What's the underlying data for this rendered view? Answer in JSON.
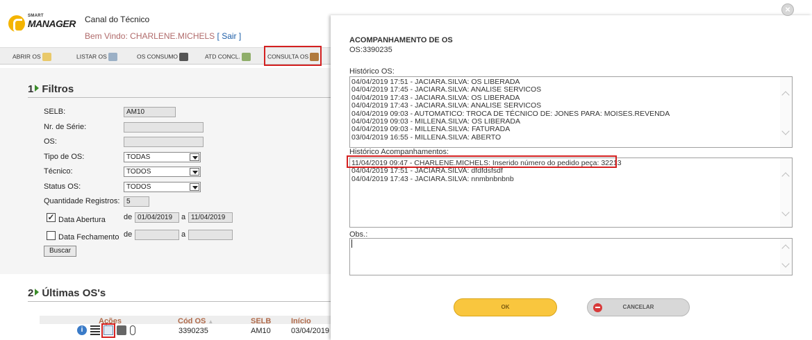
{
  "header": {
    "logo_small": "SMART",
    "logo_big": "MANAGER",
    "title": "Canal do Técnico",
    "welcome_text": "Bem Vindo: CHARLENE.MICHELS",
    "logout": "[ Sair ]"
  },
  "nav": {
    "items": [
      "ABRIR OS",
      "LISTAR OS",
      "OS CONSUMO",
      "ATD CONCL.",
      "CONSULTA OS"
    ],
    "active": "CONSULTA OS"
  },
  "filters": {
    "section_num": "1",
    "section_title": "Filtros",
    "selb_label": "SELB:",
    "selb_value": "AM10",
    "serie_label": "Nr. de Série:",
    "os_label": "OS:",
    "tipo_label": "Tipo de OS:",
    "tipo_value": "TODAS",
    "tecnico_label": "Técnico:",
    "tecnico_value": "TODOS",
    "status_label": "Status OS:",
    "status_value": "TODOS",
    "qtd_label": "Quantidade Registros:",
    "qtd_value": "5",
    "abertura_label": "Data Abertura",
    "abertura_checked": true,
    "de_label": "de",
    "a_label": "a",
    "abertura_from": "01/04/2019",
    "abertura_to": "11/04/2019",
    "fechamento_label": "Data Fechamento",
    "fechamento_checked": false,
    "search_button": "Buscar"
  },
  "latest": {
    "section_num": "2",
    "section_title": "Últimas OS's",
    "columns": [
      "Ações",
      "Cód OS",
      "SELB",
      "Início"
    ],
    "rows": [
      {
        "cod_os": "3390235",
        "selb": "AM10",
        "inicio": "03/04/2019"
      }
    ]
  },
  "modal": {
    "title": "ACOMPANHAMENTO DE OS",
    "os_label": "OS:3390235",
    "historico_label": "Histórico OS:",
    "historico": [
      "04/04/2019 17:51 - JACIARA.SILVA: OS LIBERADA",
      "04/04/2019 17:45 - JACIARA.SILVA: ANALISE SERVICOS",
      "04/04/2019 17:43 - JACIARA.SILVA: OS LIBERADA",
      "04/04/2019 17:43 - JACIARA.SILVA: ANALISE SERVICOS",
      "04/04/2019 09:03 - AUTOMATICO: TROCA DE TÉCNICO    DE: JONES  PARA: MOISES.REVENDA",
      "04/04/2019 09:03 - MILLENA.SILVA: OS LIBERADA",
      "04/04/2019 09:03 - MILLENA.SILVA: FATURADA",
      "03/04/2019 16:55 - MILLENA.SILVA: ABERTO"
    ],
    "acompanhamentos_label": "Histórico Acompanhamentos:",
    "acompanhamentos": [
      "11/04/2019 09:47 - CHARLENE.MICHELS: Inserido número do pedido peça: 32213",
      "04/04/2019 17:51 - JACIARA.SILVA: dfdfdsfsdf",
      "04/04/2019 17:43 - JACIARA.SILVA: nnmbnbnbnb"
    ],
    "obs_label": "Obs.:",
    "obs_value": "",
    "ok_button": "OK",
    "cancel_button": "CANCELAR"
  },
  "colors": {
    "highlight": "#d42020",
    "ok": "#f9c63e",
    "cancel": "#d8d8d8",
    "brand": "#f4b400",
    "section_arrow": "#3b8c2a"
  }
}
